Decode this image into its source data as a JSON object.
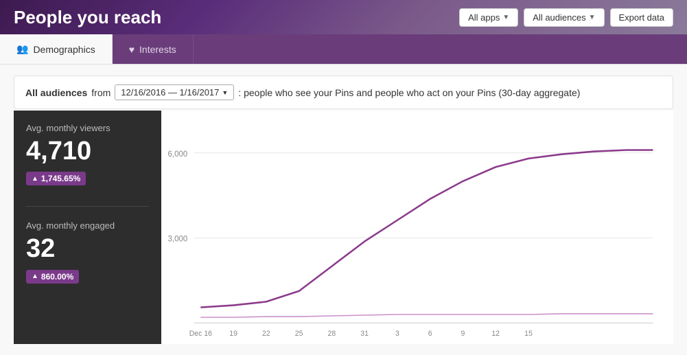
{
  "header": {
    "title": "People you reach",
    "controls": {
      "all_apps_label": "All apps",
      "all_audiences_label": "All audiences",
      "export_data_label": "Export data"
    }
  },
  "tabs": [
    {
      "id": "demographics",
      "label": "Demographics",
      "icon": "👥",
      "active": true
    },
    {
      "id": "interests",
      "label": "Interests",
      "icon": "♥",
      "active": false
    }
  ],
  "filter_bar": {
    "prefix": "All audiences",
    "from_label": "from",
    "date_range": "12/16/2016 — 1/16/2017",
    "suffix": ": people who see your Pins and people who act on your Pins (30-day aggregate)"
  },
  "stats": {
    "viewers": {
      "label": "Avg. monthly viewers",
      "value": "4,710",
      "badge": "▲ 1,745.65%"
    },
    "engaged": {
      "label": "Avg. monthly engaged",
      "value": "32",
      "badge": "▲ 860.00%"
    }
  },
  "chart": {
    "y_labels": [
      "6,000",
      "3,000",
      ""
    ],
    "x_labels": [
      "Dec 16",
      "19",
      "22",
      "25",
      "28",
      "31",
      "3",
      "6",
      "9",
      "12",
      "15"
    ],
    "colors": {
      "line1": "#8b3a8b",
      "line2": "#c990c9"
    }
  }
}
